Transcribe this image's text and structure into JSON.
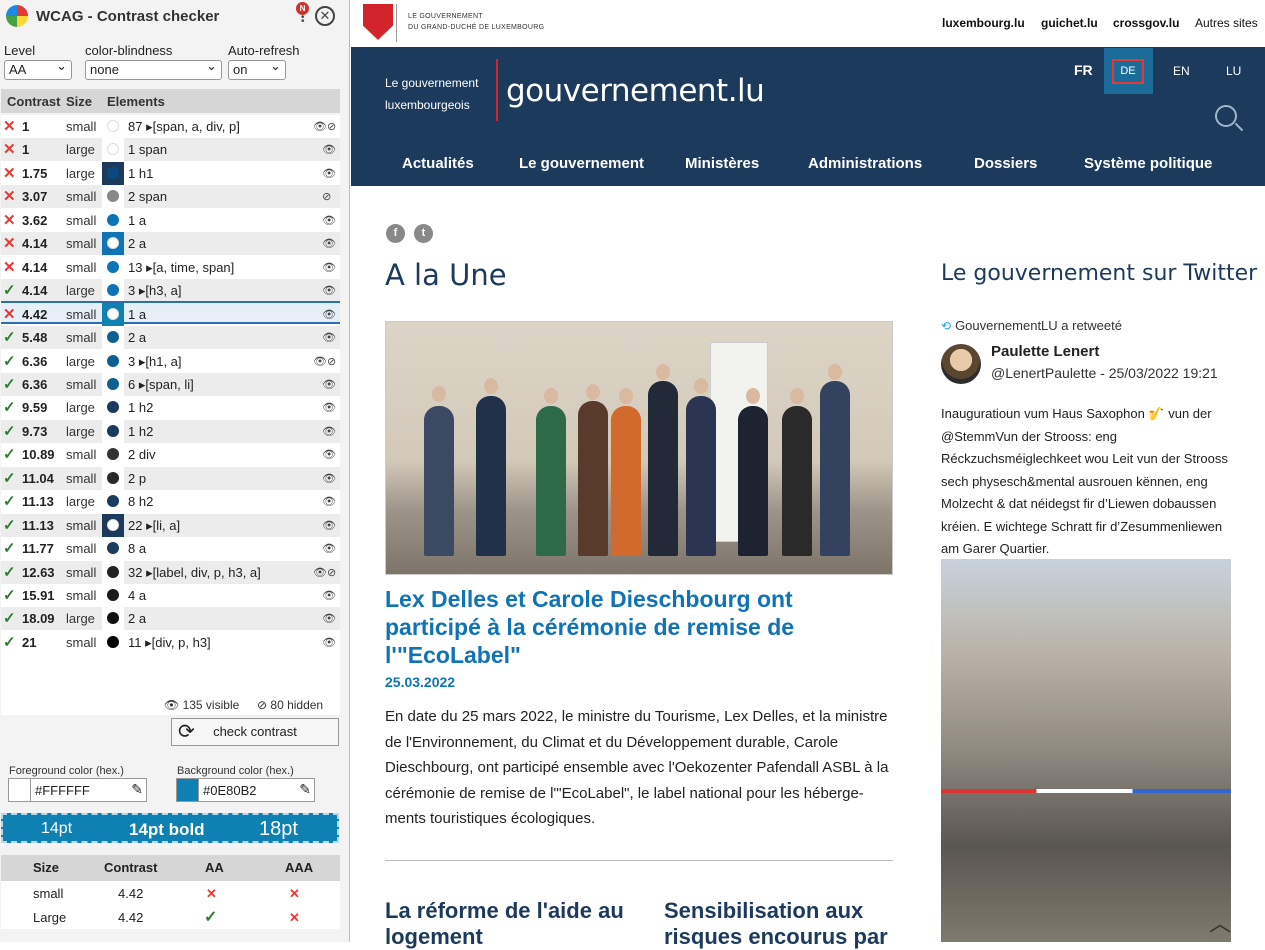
{
  "extension": {
    "title": "WCAG - Contrast checker",
    "notification_badge": "N",
    "close_symbol": "✕",
    "controls": {
      "level_label": "Level",
      "level_value": "AA",
      "colorblind_label": "color-blindness",
      "colorblind_value": "none",
      "autorefresh_label": "Auto-refresh",
      "autorefresh_value": "on"
    },
    "table_headers": {
      "contrast": "Contrast",
      "size": "Size",
      "elements": "Elements"
    },
    "rows": [
      {
        "status": "✕",
        "pass": false,
        "contrast": "1",
        "size": "small",
        "color": "#ffffff",
        "bg": "#ffffff",
        "count": "87",
        "elements": "▸[span, a, div, p]",
        "vis": "both"
      },
      {
        "status": "✕",
        "pass": false,
        "contrast": "1",
        "size": "large",
        "color": "#ffffff",
        "bg": "#ffffff",
        "count": "1",
        "elements": "span",
        "vis": "eye"
      },
      {
        "status": "✕",
        "pass": false,
        "contrast": "1.75",
        "size": "large",
        "color": "#0b4a80",
        "bg": "#1b3a5c",
        "count": "1",
        "elements": "h1",
        "vis": "eye"
      },
      {
        "status": "✕",
        "pass": false,
        "contrast": "3.07",
        "size": "small",
        "color": "#888888",
        "bg": "#ffffff",
        "count": "2",
        "elements": "span",
        "vis": "hidden"
      },
      {
        "status": "✕",
        "pass": false,
        "contrast": "3.62",
        "size": "small",
        "color": "#0f73b5",
        "bg": "#ffffff",
        "count": "1",
        "elements": "a",
        "vis": "eye"
      },
      {
        "status": "✕",
        "pass": false,
        "contrast": "4.14",
        "size": "small",
        "color": "#ffffff",
        "bg": "#0f73b5",
        "count": "2",
        "elements": "a",
        "vis": "eye"
      },
      {
        "status": "✕",
        "pass": false,
        "contrast": "4.14",
        "size": "small",
        "color": "#0f73b5",
        "bg": "#ffffff",
        "count": "13",
        "elements": "▸[a, time, span]",
        "vis": "eye"
      },
      {
        "status": "✓",
        "pass": true,
        "contrast": "4.14",
        "size": "large",
        "color": "#0f73b5",
        "bg": "#ffffff",
        "count": "3",
        "elements": "▸[h3, a]",
        "vis": "eye"
      },
      {
        "status": "✕",
        "pass": false,
        "contrast": "4.42",
        "size": "small",
        "color": "#ffffff",
        "bg": "#0e80b2",
        "count": "1",
        "elements": "a",
        "vis": "eye",
        "selected": true
      },
      {
        "status": "✓",
        "pass": true,
        "contrast": "5.48",
        "size": "small",
        "color": "#0b5f93",
        "bg": "#ffffff",
        "count": "2",
        "elements": "a",
        "vis": "eye"
      },
      {
        "status": "✓",
        "pass": true,
        "contrast": "6.36",
        "size": "large",
        "color": "#0b5f93",
        "bg": "#ffffff",
        "count": "3",
        "elements": "▸[h1, a]",
        "vis": "both"
      },
      {
        "status": "✓",
        "pass": true,
        "contrast": "6.36",
        "size": "small",
        "color": "#0b5f93",
        "bg": "#ffffff",
        "count": "6",
        "elements": "▸[span, li]",
        "vis": "eye"
      },
      {
        "status": "✓",
        "pass": true,
        "contrast": "9.59",
        "size": "large",
        "color": "#1b3a5c",
        "bg": "#ffffff",
        "count": "1",
        "elements": "h2",
        "vis": "eye"
      },
      {
        "status": "✓",
        "pass": true,
        "contrast": "9.73",
        "size": "large",
        "color": "#1b3a5c",
        "bg": "#ffffff",
        "count": "1",
        "elements": "h2",
        "vis": "eye"
      },
      {
        "status": "✓",
        "pass": true,
        "contrast": "10.89",
        "size": "small",
        "color": "#333333",
        "bg": "#ffffff",
        "count": "2",
        "elements": "div",
        "vis": "eye"
      },
      {
        "status": "✓",
        "pass": true,
        "contrast": "11.04",
        "size": "small",
        "color": "#2a2a2a",
        "bg": "#ffffff",
        "count": "2",
        "elements": "p",
        "vis": "eye"
      },
      {
        "status": "✓",
        "pass": true,
        "contrast": "11.13",
        "size": "large",
        "color": "#1b3a5c",
        "bg": "#ffffff",
        "count": "8",
        "elements": "h2",
        "vis": "eye"
      },
      {
        "status": "✓",
        "pass": true,
        "contrast": "11.13",
        "size": "small",
        "color": "#ffffff",
        "bg": "#1b3a5c",
        "count": "22",
        "elements": "▸[li, a]",
        "vis": "eye"
      },
      {
        "status": "✓",
        "pass": true,
        "contrast": "11.77",
        "size": "small",
        "color": "#1b3a5c",
        "bg": "#ffffff",
        "count": "8",
        "elements": "a",
        "vis": "eye"
      },
      {
        "status": "✓",
        "pass": true,
        "contrast": "12.63",
        "size": "small",
        "color": "#222222",
        "bg": "#ffffff",
        "count": "32",
        "elements": "▸[label, div, p, h3, a]",
        "vis": "both"
      },
      {
        "status": "✓",
        "pass": true,
        "contrast": "15.91",
        "size": "small",
        "color": "#1a1a1a",
        "bg": "#ffffff",
        "count": "4",
        "elements": "a",
        "vis": "eye"
      },
      {
        "status": "✓",
        "pass": true,
        "contrast": "18.09",
        "size": "large",
        "color": "#111111",
        "bg": "#ffffff",
        "count": "2",
        "elements": "a",
        "vis": "eye"
      },
      {
        "status": "✓",
        "pass": true,
        "contrast": "21",
        "size": "small",
        "color": "#000000",
        "bg": "#ffffff",
        "count": "11",
        "elements": "▸[div, p, h3]",
        "vis": "eye"
      }
    ],
    "visible_count": "135 visible",
    "hidden_count": "80 hidden",
    "check_button": "check contrast",
    "fg_label": "Foreground color (hex.)",
    "fg_value": "#FFFFFF",
    "bg_label": "Background color (hex.)",
    "bg_value": "#0E80B2",
    "preview": {
      "t1": "14pt",
      "t2": "14pt bold",
      "t3": "18pt"
    },
    "result_headers": {
      "size": "Size",
      "contrast": "Contrast",
      "aa": "AA",
      "aaa": "AAA"
    },
    "results": [
      {
        "size": "small",
        "contrast": "4.42",
        "aa": "✕",
        "aa_pass": false,
        "aaa": "✕",
        "aaa_pass": false
      },
      {
        "size": "Large",
        "contrast": "4.42",
        "aa": "✓",
        "aa_pass": true,
        "aaa": "✕",
        "aaa_pass": false
      }
    ]
  },
  "site": {
    "gov_line1": "LE GOUVERNEMENT",
    "gov_line2": "DU GRAND-DUCHÉ DE LUXEMBOURG",
    "top_links": [
      "luxembourg.lu",
      "guichet.lu",
      "crossgov.lu"
    ],
    "other_sites": "Autres sites",
    "brand_line1": "Le gouvernement",
    "brand_line2": "luxembourgeois",
    "brand_name": "gouvernement.lu",
    "languages": [
      "FR",
      "DE",
      "EN",
      "LU"
    ],
    "menu": [
      "Actualités",
      "Le gouvernement",
      "Ministères",
      "Administrations",
      "Dossiers",
      "Système politique"
    ],
    "social": [
      "f",
      "t"
    ],
    "section_title": "A la Une",
    "article": {
      "title": "Lex Delles et Carole Dieschbourg ont participé à la cérémonie de remise de l'\"EcoLabel\"",
      "date": "25.03.2022",
      "body": "En date du 25 mars 2022, le ministre du Tourisme, Lex Delles, et la ministre de l'Environnement, du Climat et du Développement durable, Carole Dieschbourg, ont participé ensemble avec l'Oekozenter Pafendall ASBL à la cérémonie de remise de l'\"EcoLabel\", le label national pour les héberge-ments touristiques écologiques."
    },
    "sub1": "La réforme de l'aide au logement",
    "sub2": "Sensibilisation aux risques encourus par",
    "twitter_title": "Le gouvernement sur Twitter",
    "retweet": "GouvernementLU a retweeté",
    "tweet_name": "Paulette Lenert",
    "tweet_handle": "@LenertPaulette - 25/03/2022 19:21",
    "tweet_text": "Inauguratioun vum Haus Saxophon 🎷 vun der @StemmVun der Strooss: eng Réckzuchsméiglechkeet wou Leit vun der Strooss sech physesch&mental ausrouen kënnen, eng Molzecht & dat néidegst fir d’Liewen dobaussen kréien. E wichtege Schratt fir d’Zesummenliewen am Garer Quartier."
  }
}
